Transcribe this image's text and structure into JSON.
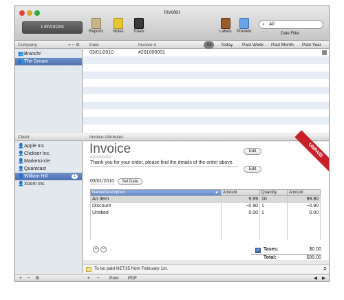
{
  "window": {
    "title": "Involer"
  },
  "toolbar": {
    "invoices_button": "1 INVOICES",
    "reports": "Reports",
    "notes": "Notes",
    "totals": "Totals",
    "labels": "Labels",
    "preview": "Preview",
    "search_placeholder": "All",
    "date_filter": "Date Filter"
  },
  "company_panel": {
    "header": "Company",
    "controls": "+ − ⚙",
    "items": [
      {
        "name": "Branchr"
      },
      {
        "name": "The Dream"
      }
    ]
  },
  "invoice_list": {
    "col_date": "Date",
    "col_invoice": "Invoice #",
    "filters": [
      "All",
      "Today",
      "Past Week",
      "Past Month",
      "Past Year"
    ],
    "rows": [
      {
        "date": "03/01/2010",
        "number": "#201000001"
      }
    ]
  },
  "client_panel": {
    "header": "Client",
    "items": [
      {
        "name": "Apple Inc."
      },
      {
        "name": "Clicksor Inc."
      },
      {
        "name": "Marketcircle"
      },
      {
        "name": "Quantcast"
      },
      {
        "name": "William Hill",
        "badge": "1"
      },
      {
        "name": "Xoom Inc."
      }
    ]
  },
  "attributes": {
    "header": "Invoice Attributes"
  },
  "invoice": {
    "heading": "Invoice",
    "number": "#201000001",
    "message": "Thank you for your order, please find the details of the order above.",
    "edit1": "Edit",
    "edit2": "Edit",
    "date": "03/01/2010",
    "set_date": "Set Date",
    "ribbon": "UNPAID",
    "columns": [
      "Name/Description",
      "Amount",
      "Quantity",
      "Amount"
    ],
    "items": [
      {
        "name": "An Item",
        "amount": "9.99",
        "qty": "10",
        "total": "99.90"
      },
      {
        "name": "Discount",
        "amount": "−0.90",
        "qty": "1",
        "total": "−0.90"
      },
      {
        "name": "Untitled",
        "amount": "0.00",
        "qty": "1",
        "total": "0.00"
      }
    ],
    "taxes_label": "Taxes:",
    "taxes_value": "$0.00",
    "total_label": "Total:",
    "total_value": "$99.00"
  },
  "note": {
    "text": "To be paid NET15 from February 1st."
  },
  "bottom": {
    "left": "+ − ⚙",
    "print": "Print",
    "pdf": "PDF"
  },
  "colors": {
    "selection": "#4d72b0",
    "ribbon": "#c8202a",
    "stripe": "#e7edf7"
  }
}
